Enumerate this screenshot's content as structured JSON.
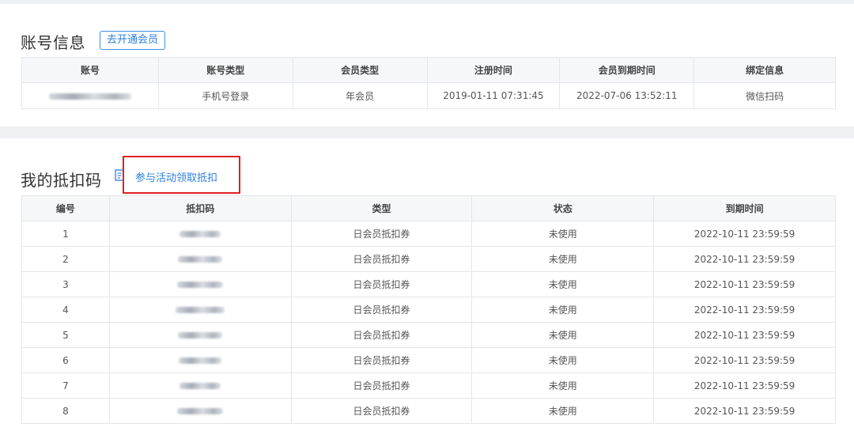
{
  "account_section": {
    "title": "账号信息",
    "vip_button": "去开通会员",
    "headers": [
      "账号",
      "账号类型",
      "会员类型",
      "注册时间",
      "会员到期时间",
      "绑定信息"
    ],
    "row": {
      "account": "",
      "account_type": "手机号登录",
      "member_type": "年会员",
      "register_time": "2019-01-11 07:31:45",
      "expire_time": "2022-07-06 13:52:11",
      "binding": "微信扫码"
    }
  },
  "coupon_section": {
    "title": "我的抵扣码",
    "activity_link": "参与活动领取抵扣",
    "highlight_color": "#e02121",
    "headers": [
      "编号",
      "抵扣码",
      "类型",
      "状态",
      "到期时间"
    ],
    "rows": [
      {
        "no": "1",
        "code": "",
        "type": "日会员抵扣券",
        "status": "未使用",
        "expire": "2022-10-11 23:59:59"
      },
      {
        "no": "2",
        "code": "",
        "type": "日会员抵扣券",
        "status": "未使用",
        "expire": "2022-10-11 23:59:59"
      },
      {
        "no": "3",
        "code": "",
        "type": "日会员抵扣券",
        "status": "未使用",
        "expire": "2022-10-11 23:59:59"
      },
      {
        "no": "4",
        "code": "",
        "type": "日会员抵扣券",
        "status": "未使用",
        "expire": "2022-10-11 23:59:59"
      },
      {
        "no": "5",
        "code": "",
        "type": "日会员抵扣券",
        "status": "未使用",
        "expire": "2022-10-11 23:59:59"
      },
      {
        "no": "6",
        "code": "",
        "type": "日会员抵扣券",
        "status": "未使用",
        "expire": "2022-10-11 23:59:59"
      },
      {
        "no": "7",
        "code": "",
        "type": "日会员抵扣券",
        "status": "未使用",
        "expire": "2022-10-11 23:59:59"
      },
      {
        "no": "8",
        "code": "",
        "type": "日会员抵扣券",
        "status": "未使用",
        "expire": "2022-10-11 23:59:59"
      }
    ]
  },
  "icons": {
    "coupon_title_icon": "document-icon"
  }
}
